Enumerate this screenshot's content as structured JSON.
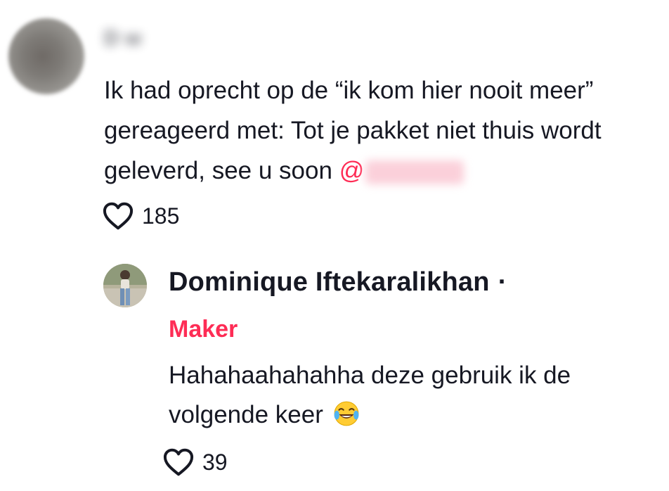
{
  "comment": {
    "username": "D w",
    "text": "Ik had oprecht op de “ik kom hier nooit meer” gereageerd met: Tot je pakket niet thuis wordt geleverd, see u soon",
    "mention_prefix": "@",
    "likes": "185",
    "icons": {
      "like": "heart-outline-icon"
    }
  },
  "reply": {
    "author_name": "Dominique Iftekaralikhan",
    "separator": "·",
    "badge": "Maker",
    "text": "Hahahaahahahha deze gebruik ik de volgende keer",
    "emoji": "😂",
    "likes": "39",
    "icons": {
      "like": "heart-outline-icon",
      "emoji": "face-with-tears-of-joy-icon"
    }
  },
  "colors": {
    "text": "#161823",
    "accent": "#fe2c55",
    "background": "#ffffff"
  }
}
